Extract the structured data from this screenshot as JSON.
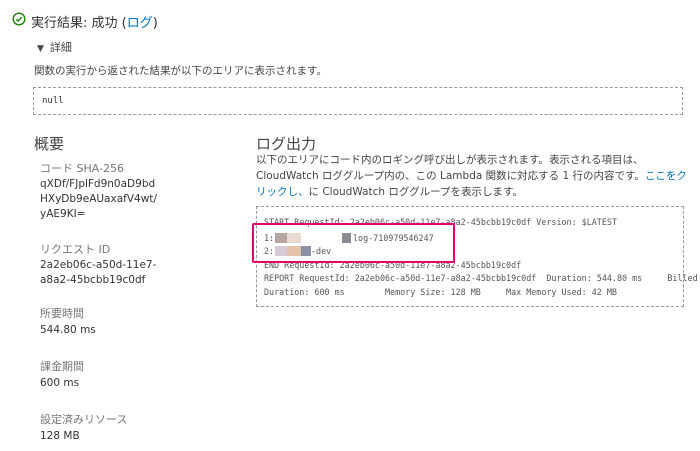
{
  "colors": {
    "success_green": "#1d8102",
    "link_blue": "#0073bb",
    "highlight": "#e8006e"
  },
  "header": {
    "status_icon": "check-circle-icon",
    "title_prefix": "実行結果: 成功 (",
    "log_link": "ログ",
    "title_suffix": ")"
  },
  "details": {
    "toggle_icon": "caret-down-icon",
    "toggle_label": "詳細",
    "description": "関数の実行から返された結果が以下のエリアに表示されます。",
    "output": "null"
  },
  "summary": {
    "heading": "概要",
    "fields": [
      {
        "label": "コード SHA-256",
        "value": "qXDf/FJplFd9n0aD9bd HXyDb9eAUaxafV4wt/ yAE9KI="
      },
      {
        "label": "リクエスト ID",
        "value": "2a2eb06c-a50d-11e7-a8a2-45bcbb19c0df"
      },
      {
        "label": "所要時間",
        "value": "544.80 ms"
      },
      {
        "label": "課金期間",
        "value": "600 ms"
      },
      {
        "label": "設定済みリソース",
        "value": "128 MB"
      }
    ]
  },
  "log_output": {
    "heading": "ログ出力",
    "description_before": "以下のエリアにコード内のロギング呼び出しが表示されます。表示される項目は、CloudWatch ロググループ内の、この Lambda 関数に対応する 1 行の内容です。",
    "link": "ここをクリックし、",
    "description_after": "に CloudWatch ロググループを表示します。",
    "lines": {
      "start": "START RequestId: 2a2eb06c-a50d-11e7-a8a2-45bcbb19c0df Version: $LATEST",
      "line1_prefix": "1:",
      "line1_suffix": "log-710979546247",
      "line2_prefix": "2:",
      "line2_suffix": "-dev",
      "end": "END RequestId: 2a2eb06c-a50d-11e7-a8a2-45bcbb19c0df",
      "report": "REPORT RequestId: 2a2eb06c-a50d-11e7-a8a2-45bcbb19c0df  Duration: 544.80 ms     Billed",
      "duration": "Duration: 600 ms        Memory Size: 128 MB     Max Memory Used: 42 MB"
    }
  }
}
